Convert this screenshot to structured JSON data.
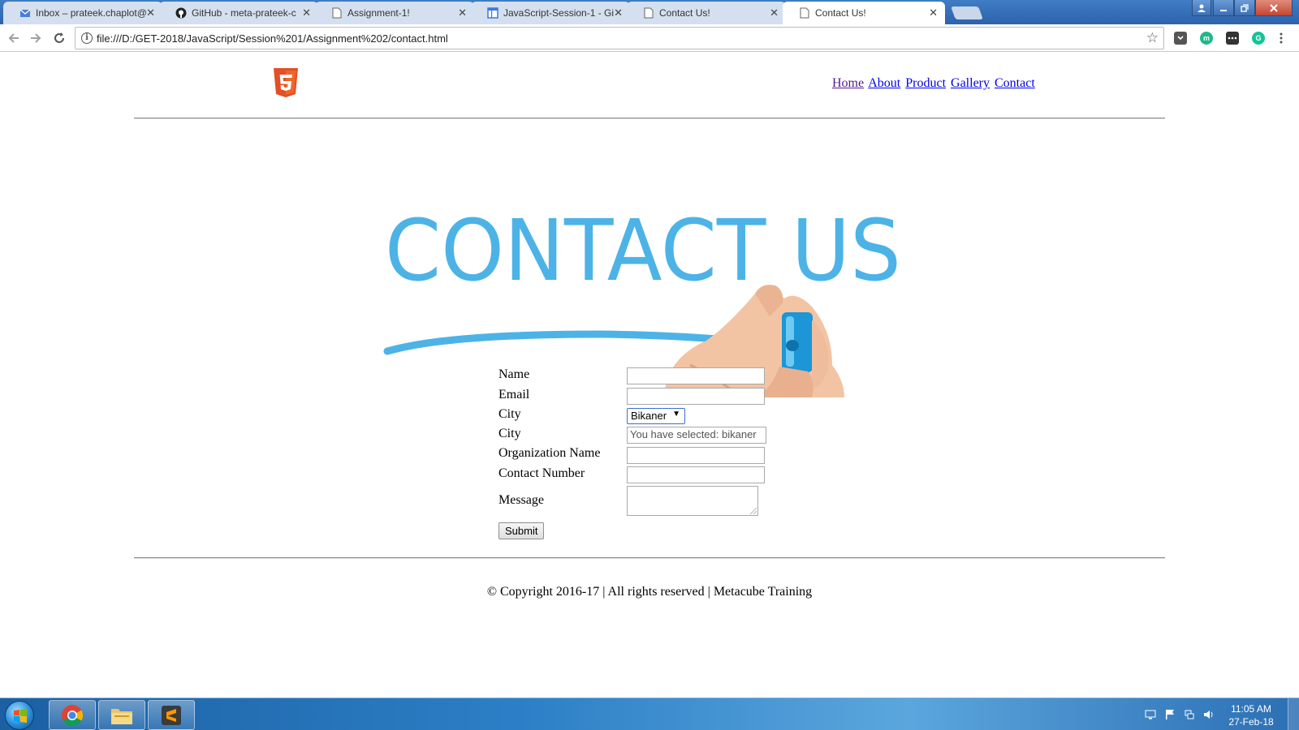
{
  "browser": {
    "tabs": [
      {
        "title": "Inbox – prateek.chaplot@",
        "icon": "mail-icon",
        "active": false
      },
      {
        "title": "GitHub - meta-prateek-c",
        "icon": "github-icon",
        "active": false
      },
      {
        "title": "Assignment-1!",
        "icon": "page-icon",
        "active": false
      },
      {
        "title": "JavaScript-Session-1 - Gi",
        "icon": "docs-icon",
        "active": false
      },
      {
        "title": "Contact Us!",
        "icon": "page-icon",
        "active": false
      },
      {
        "title": "Contact Us!",
        "icon": "page-icon",
        "active": true
      }
    ],
    "close_glyph": "✕",
    "url": "file:///D:/GET-2018/JavaScript/Session%201/Assignment%202/contact.html",
    "extensions": [
      "pocket-icon",
      "mercury-icon",
      "menu-extension-icon",
      "grammarly-icon"
    ]
  },
  "site": {
    "nav": [
      "Home",
      "About",
      "Product",
      "Gallery",
      "Contact"
    ],
    "banner": {
      "heading": "CONTACT US",
      "colors": {
        "text": "#4db3e6",
        "marker": "#3aa6e0"
      }
    },
    "form": {
      "name_label": "Name",
      "email_label": "Email",
      "city_label": "City",
      "city_selected": "Bikaner",
      "city_display_label": "City",
      "city_display_value": "You have selected: bikaner",
      "org_label": "Organization Name",
      "contact_label": "Contact Number",
      "message_label": "Message",
      "submit_label": "Submit"
    },
    "footer": "© Copyright 2016-17 | All rights reserved | Metacube Training",
    "colors": {
      "link": "#0000ee",
      "visited_link": "#551a8b",
      "html5_orange": "#e34f26"
    }
  },
  "taskbar": {
    "apps": [
      "chrome-icon",
      "file-explorer-icon",
      "sublime-text-icon"
    ],
    "time": "11:05 AM",
    "date": "27-Feb-18"
  }
}
